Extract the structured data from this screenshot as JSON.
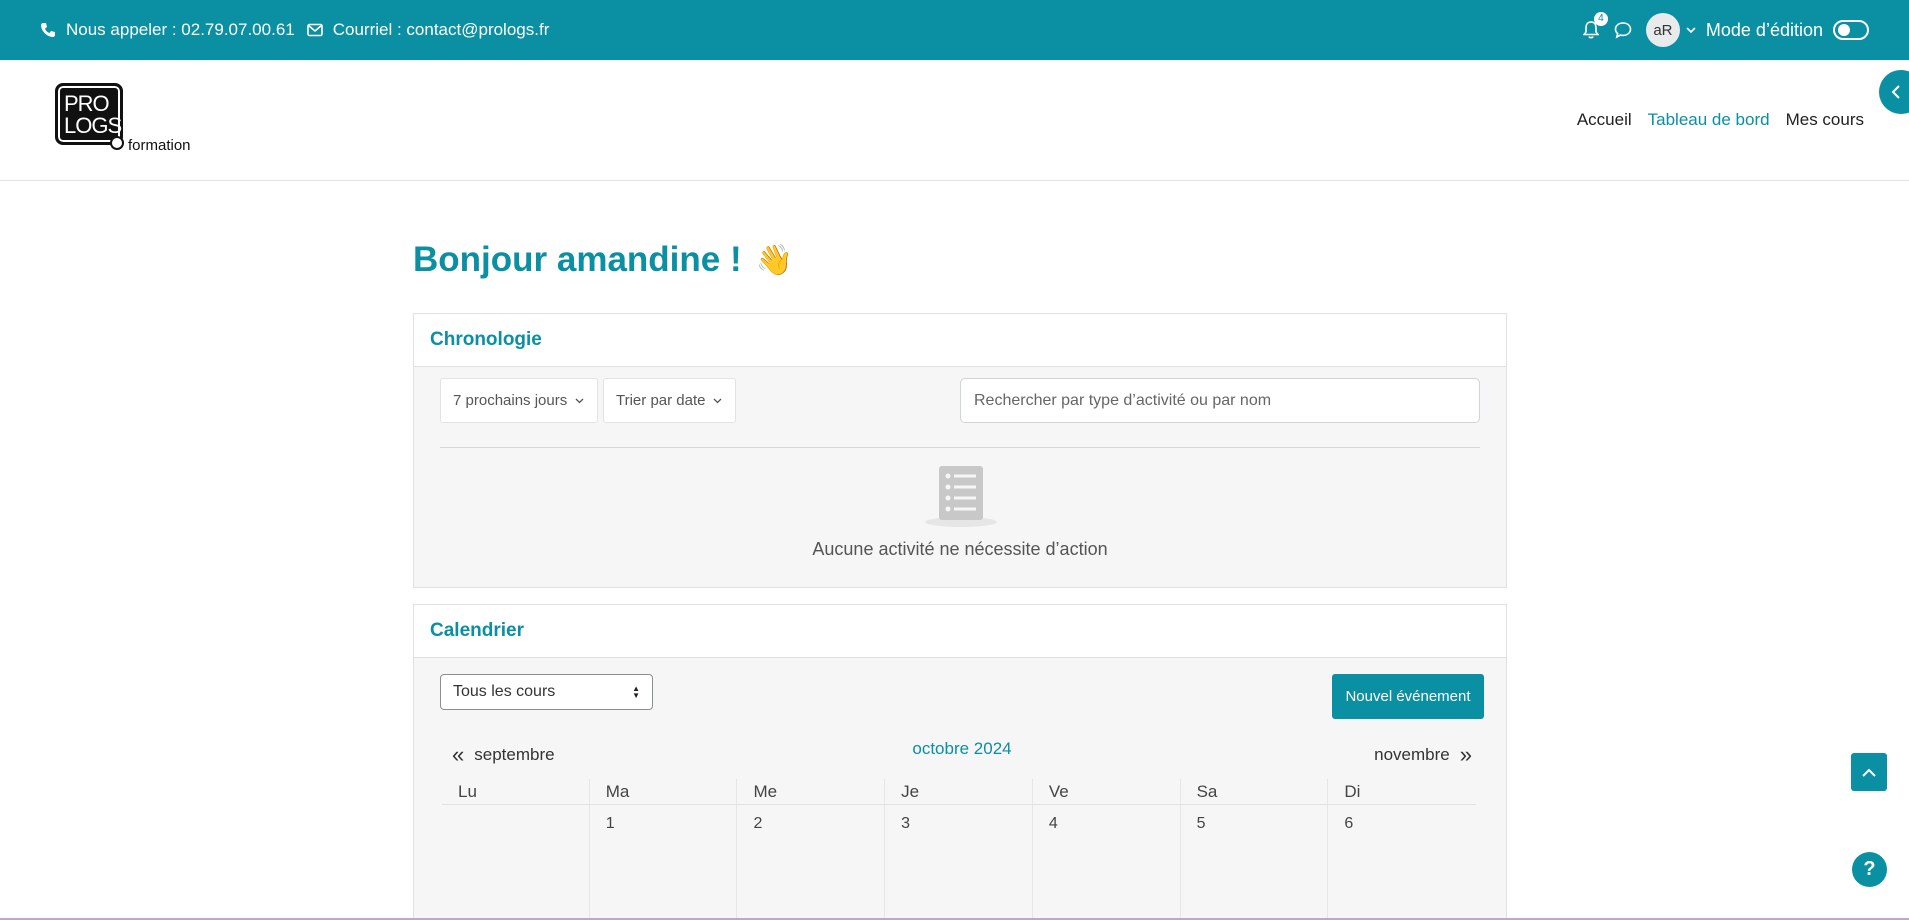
{
  "topbar": {
    "phone_label": "Nous appeler : 02.79.07.00.61",
    "email_label": "Courriel : contact@prologs.fr",
    "notification_count": "4",
    "avatar_initials": "aR",
    "edit_mode_label": "Mode d’édition",
    "edit_mode_on": false,
    "color": "#0b8fa3"
  },
  "logo": {
    "line1": "PRO",
    "line2": "LOGS",
    "word": "formation"
  },
  "nav": {
    "items": [
      {
        "label": "Accueil",
        "active": false
      },
      {
        "label": "Tableau de bord",
        "active": true
      },
      {
        "label": "Mes cours",
        "active": false
      }
    ]
  },
  "greeting": {
    "text": "Bonjour amandine !",
    "emoji": "👋"
  },
  "timeline": {
    "title": "Chronologie",
    "filter_days": "7 prochains jours",
    "sort": "Trier par date",
    "search_placeholder": "Rechercher par type d’activité ou par nom",
    "empty_text": "Aucune activité ne nécessite d’action"
  },
  "calendar": {
    "title": "Calendrier",
    "course_filter": "Tous les cours",
    "new_event_label": "Nouvel événement",
    "prev_month": "septembre",
    "current_month": "octobre 2024",
    "next_month": "novembre",
    "weekdays": [
      "Lu",
      "Ma",
      "Me",
      "Je",
      "Ve",
      "Sa",
      "Di"
    ],
    "first_week": [
      "",
      "1",
      "2",
      "3",
      "4",
      "5",
      "6"
    ]
  },
  "help_label": "?"
}
